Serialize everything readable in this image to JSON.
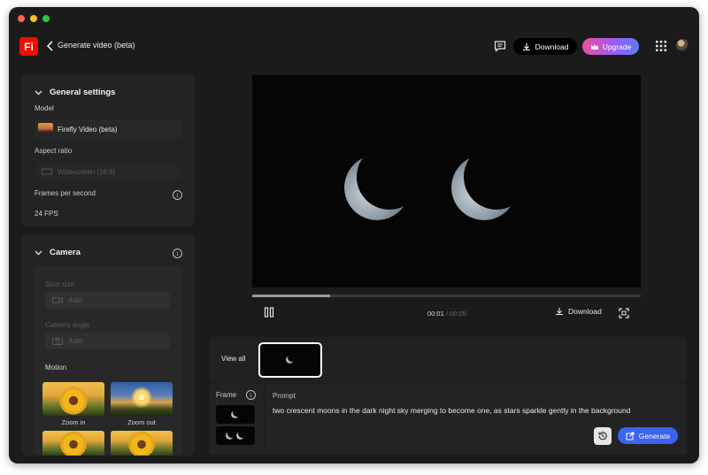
{
  "header": {
    "logo_text": "Fi",
    "title": "Generate video (beta)",
    "download_label": "Download",
    "upgrade_label": "Upgrade"
  },
  "general_settings": {
    "title": "General settings",
    "model_label": "Model",
    "model_value": "Firefly Video (beta)",
    "aspect_label": "Aspect ratio",
    "aspect_value": "Widescreen (16:9)",
    "fps_label": "Frames per second",
    "fps_value": "24 FPS"
  },
  "camera": {
    "title": "Camera",
    "shot_size_label": "Shot size",
    "shot_size_value": "Auto",
    "angle_label": "Camera angle",
    "angle_value": "Auto",
    "motion_label": "Motion",
    "motion_options": [
      "Zoom in",
      "Zoom out"
    ]
  },
  "player": {
    "current_time": "00:01",
    "duration": "/ 00:05",
    "progress": 0.2,
    "download_label": "Download"
  },
  "strip": {
    "view_all_label": "View all"
  },
  "prompt": {
    "frame_label": "Frame",
    "label": "Prompt",
    "text": "two crescent moons in the dark night sky merging to become one, as stars sparkle gently in the background",
    "generate_label": "Generate"
  },
  "colors": {
    "accent_blue": "#3b63f0",
    "brand_red": "#eb1000"
  }
}
